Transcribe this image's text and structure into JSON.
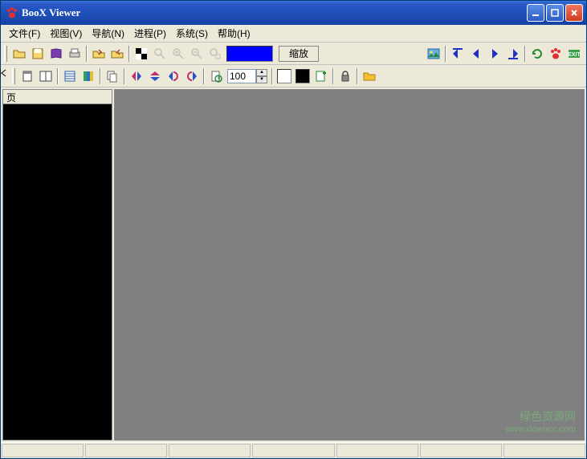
{
  "titlebar": {
    "title": "BooX Viewer"
  },
  "menubar": {
    "file": "文件(F)",
    "view": "视图(V)",
    "nav": "导航(N)",
    "process": "进程(P)",
    "system": "系统(S)",
    "help": "帮助(H)"
  },
  "toolbar1": {
    "zoom_label": "缩放"
  },
  "toolbar2": {
    "spin_value": "100"
  },
  "sidebar": {
    "header": "页"
  },
  "colors": {
    "accent_blue": "#0000ff",
    "swatch_white": "#ffffff",
    "swatch_black": "#000000",
    "titlebar_grad_top": "#3b77dd",
    "titlebar_grad_bot": "#1541a4",
    "close_red": "#d03b1f",
    "toolbar_bg": "#ece9d8",
    "main_bg": "#808080"
  },
  "watermark": {
    "line1": "绿色资源网",
    "line2": "www.downcc.com"
  },
  "icons": {
    "app": "paw-icon",
    "open": "folder-open",
    "save": "floppy",
    "book": "book",
    "print": "printer",
    "folder_out": "folder-out",
    "folder_in": "folder-in",
    "checker": "checker",
    "zoom": "magnifier",
    "zoom_in": "magnifier-plus",
    "zoom_out": "magnifier-minus",
    "zoom_sel": "magnifier-select",
    "image": "image",
    "goto_first": "goto-first",
    "prev": "arrow-left",
    "next": "arrow-right",
    "goto_last": "goto-last",
    "refresh": "refresh",
    "paw": "paw",
    "exit": "exit",
    "layout1": "layout-single",
    "layout2": "layout-double",
    "list": "list",
    "grid": "grid-color",
    "copy": "copy",
    "flip_h": "flip-h",
    "flip_v": "flip-v",
    "rotate_l": "rotate-left",
    "rotate_r": "rotate-right",
    "doc_reset": "doc-reset",
    "color_add": "color-add",
    "lock": "lock",
    "folder_y": "folder-yellow"
  }
}
